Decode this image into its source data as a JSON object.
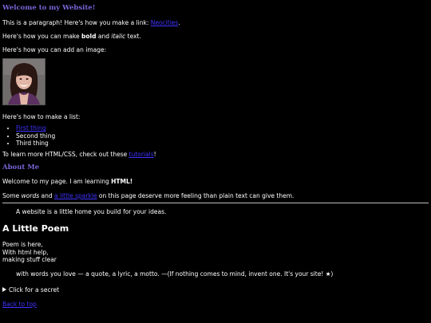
{
  "theme": {
    "accent": "#7a64d8",
    "link": "#3f33ff"
  },
  "header": {
    "title": "Welcome to my Website!"
  },
  "intro": {
    "para_prefix": "This is a paragraph! Here's how you make a link: ",
    "link_text": "Neocities",
    "para_suffix": ".",
    "bold_prefix": "Here's how you can make ",
    "bold_word": "bold",
    "and_word": " and ",
    "italic_word": "italic",
    "bold_suffix": " text.",
    "image_line": "Here's how you can add an image:"
  },
  "list_section": {
    "intro": "Here's how to make a list:",
    "items": [
      "First thing",
      "Second thing",
      "Third thing"
    ],
    "learn_prefix": "To learn more HTML/CSS, check out these ",
    "learn_link": "tutorials",
    "learn_suffix": "!"
  },
  "about": {
    "title": "About Me",
    "welcome_prefix": "Welcome to my page. I am learning ",
    "welcome_bold": "HTML!",
    "some_prefix": "Some ",
    "some_em": "words",
    "some_and": " and ",
    "some_link": "a little sparkle",
    "some_suffix": " on this page deserve more feeling than plain text can give them."
  },
  "home_line": "A website is a little home you build for your ideas.",
  "poem": {
    "title": "A Little Poem",
    "lines": [
      "Poem is here,",
      "With html help,",
      "making stuff clear"
    ],
    "quote": "with words you love — a quote, a lyric, a motto. —(If nothing comes to mind, invent one. It's your site! ★)"
  },
  "secret": {
    "label": "Click for a secret"
  },
  "footer": {
    "back_to_top": "Back to top"
  },
  "icons": {
    "disclosure": "disclosure-triangle-icon",
    "photo": "profile-photo"
  }
}
